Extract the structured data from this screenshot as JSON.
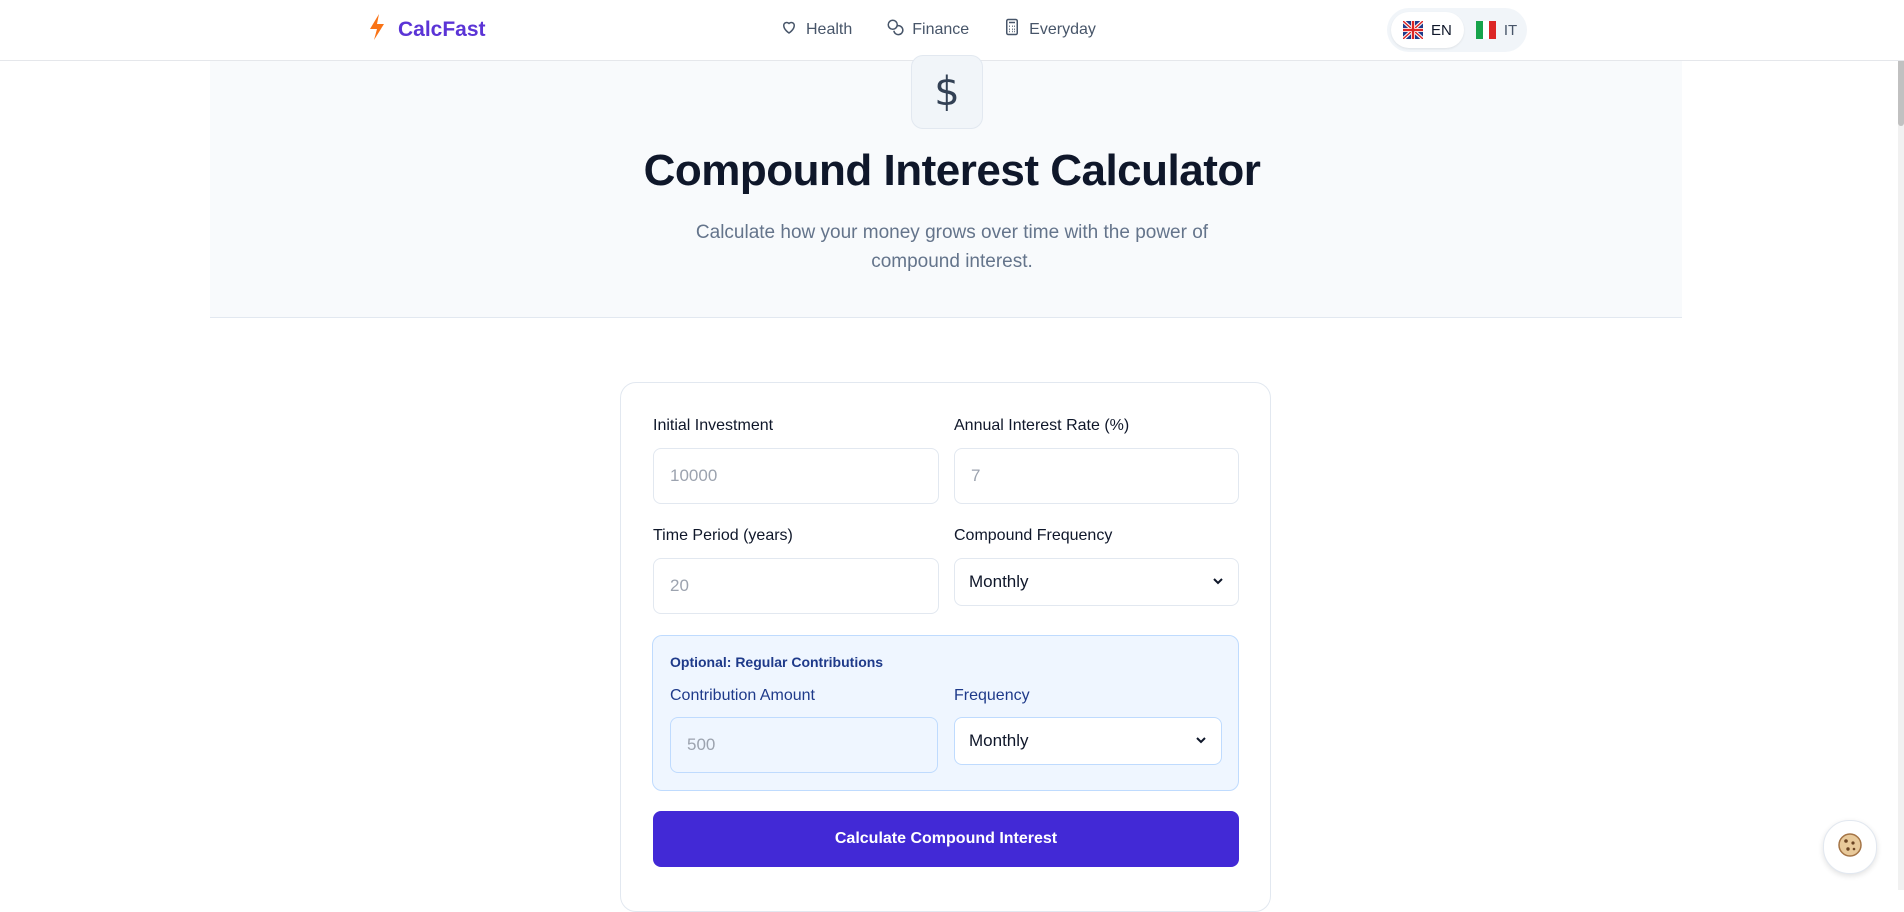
{
  "header": {
    "brand": "CalcFast",
    "nav": [
      {
        "label": "Health",
        "icon": "heart-icon"
      },
      {
        "label": "Finance",
        "icon": "coins-icon"
      },
      {
        "label": "Everyday",
        "icon": "calculator-icon"
      }
    ],
    "languages": [
      {
        "label": "EN",
        "active": true
      },
      {
        "label": "IT",
        "active": false
      }
    ]
  },
  "hero": {
    "icon_glyph": "$",
    "title": "Compound Interest Calculator",
    "subtitle": "Calculate how your money grows over time with the power of compound interest."
  },
  "form": {
    "initial_investment": {
      "label": "Initial Investment",
      "placeholder": "10000",
      "value": ""
    },
    "annual_rate": {
      "label": "Annual Interest Rate (%)",
      "placeholder": "7",
      "value": ""
    },
    "time_period": {
      "label": "Time Period (years)",
      "placeholder": "20",
      "value": ""
    },
    "compound_frequency": {
      "label": "Compound Frequency",
      "selected": "Monthly"
    },
    "contributions": {
      "title": "Optional: Regular Contributions",
      "amount": {
        "label": "Contribution Amount",
        "placeholder": "500",
        "value": ""
      },
      "frequency": {
        "label": "Frequency",
        "selected": "Monthly"
      }
    },
    "submit_label": "Calculate Compound Interest"
  },
  "colors": {
    "brand": "#5b34d6",
    "primary_button": "#4229d6",
    "contrib_bg": "#eff6ff",
    "contrib_border": "#bfdbfe"
  }
}
